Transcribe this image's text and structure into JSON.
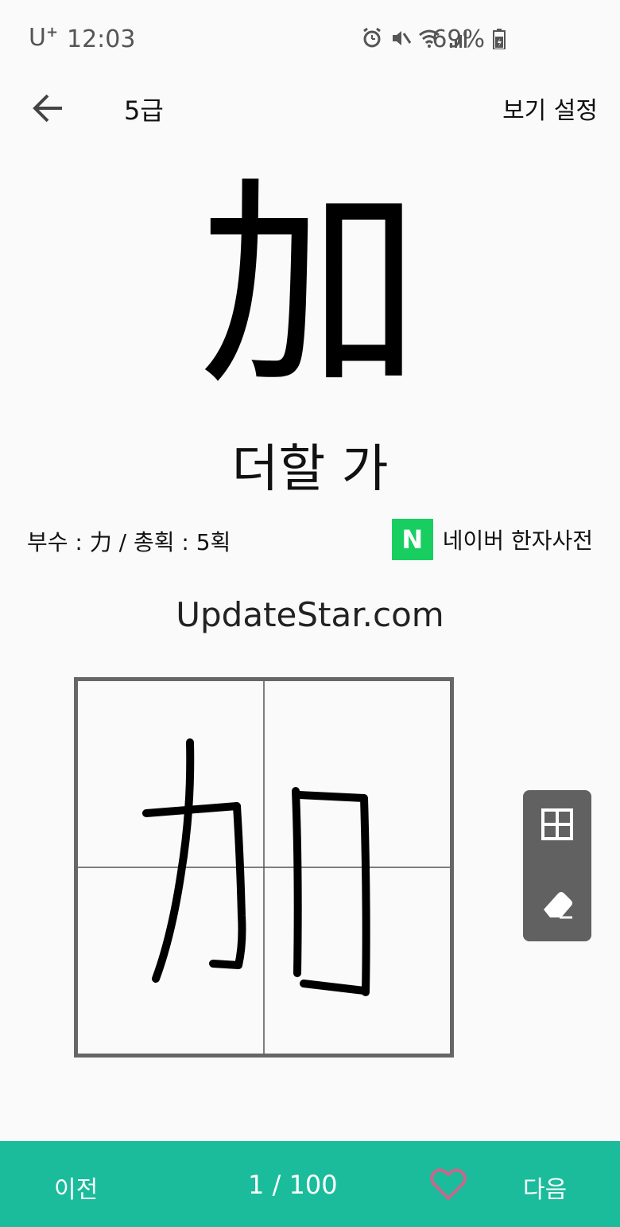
{
  "status_bar": {
    "carrier": "U",
    "carrier_plus": "+",
    "time": "12:03",
    "battery": "69%"
  },
  "header": {
    "back_icon": "back-arrow-icon",
    "title": "5급",
    "settings_label": "보기 설정"
  },
  "character": {
    "hanja": "加",
    "reading": "더할 가",
    "info": "부수 : 力 / 총획 : 5획"
  },
  "naver": {
    "logo_letter": "N",
    "label": "네이버 한자사전"
  },
  "watermark": "UpdateStar.com",
  "tools": {
    "grid_icon": "grid-icon",
    "eraser_icon": "eraser-icon"
  },
  "footer": {
    "prev_label": "이전",
    "counter": "1 / 100",
    "next_label": "다음",
    "favorite_icon": "heart-icon"
  },
  "colors": {
    "accent": "#1abc9c",
    "naver": "#19ce60",
    "tool_panel": "#616161",
    "heart": "#c8688c"
  }
}
